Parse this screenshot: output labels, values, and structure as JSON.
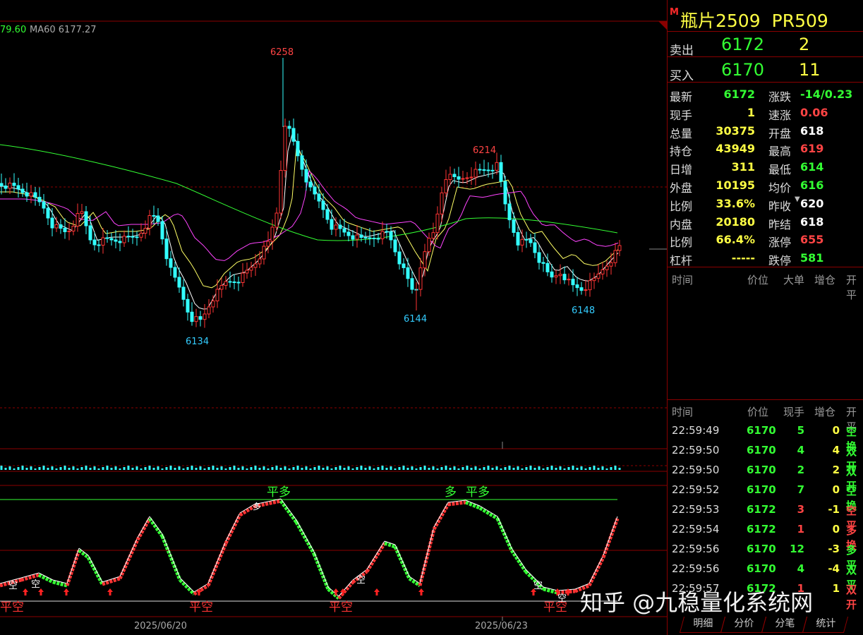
{
  "chart_data": {
    "type": "candlestick",
    "ma_legend": [
      {
        "text": "79.60",
        "color": "#33ff33"
      },
      {
        "text": "MA60 6177.27",
        "color": "#aaaaaa"
      }
    ],
    "price_labels": [
      {
        "text": "6258",
        "color": "#ff4444"
      },
      {
        "text": "6214",
        "color": "#ff4444"
      },
      {
        "text": "6134",
        "color": "#33ccff"
      },
      {
        "text": "6144",
        "color": "#33ccff"
      },
      {
        "text": "6148",
        "color": "#33ccff"
      }
    ],
    "x_axis_dates": [
      "2025/06/20",
      "2025/06/23"
    ],
    "osc_signals": [
      "平多",
      "平多",
      "多",
      "多",
      "空",
      "空",
      "空",
      "空",
      "平空",
      "平空",
      "平空",
      "平空",
      "空"
    ],
    "colors": {
      "up": "#ff3333",
      "down": "#33ffff",
      "ma5": "#ffffff",
      "ma10": "#ffff66",
      "ma20": "#ff44ff",
      "ma60": "#33ff33",
      "frame": "#8b0000"
    }
  },
  "header": {
    "marker": "M",
    "name": "瓶片2509",
    "code": "PR509"
  },
  "orderbook": [
    {
      "label": "卖出",
      "price": "6172",
      "qty": "2"
    },
    {
      "label": "买入",
      "price": "6170",
      "qty": "11"
    }
  ],
  "quote": [
    {
      "l1": "最新",
      "v1": "6172",
      "c1": "#33ff33",
      "l2": "涨跌",
      "v2": "-14/0.23",
      "c2": "#33ff33"
    },
    {
      "l1": "现手",
      "v1": "1",
      "c1": "#ffff44",
      "l2": "速涨",
      "v2": "0.06",
      "c2": "#ff4444"
    },
    {
      "l1": "总量",
      "v1": "30375",
      "c1": "#ffff44",
      "l2": "开盘",
      "v2": "618",
      "c2": "#ffffff"
    },
    {
      "l1": "持仓",
      "v1": "43949",
      "c1": "#ffff44",
      "l2": "最高",
      "v2": "619",
      "c2": "#ff4444"
    },
    {
      "l1": "日增",
      "v1": "311",
      "c1": "#ffff44",
      "l2": "最低",
      "v2": "614",
      "c2": "#33ff33"
    },
    {
      "l1": "外盘",
      "v1": "10195",
      "c1": "#ffff44",
      "l2": "均价",
      "v2": "616",
      "c2": "#33ff33"
    },
    {
      "l1": "比例",
      "v1": "33.6%",
      "c1": "#ffff44",
      "l2": "昨收",
      "v2": "620",
      "c2": "#ffffff"
    },
    {
      "l1": "内盘",
      "v1": "20180",
      "c1": "#ffff44",
      "l2": "昨结",
      "v2": "618",
      "c2": "#ffffff"
    },
    {
      "l1": "比例",
      "v1": "66.4%",
      "c1": "#ffff44",
      "l2": "涨停",
      "v2": "655",
      "c2": "#ff4444"
    },
    {
      "l1": "杠杆",
      "v1": "-----",
      "c1": "#ffff44",
      "l2": "跌停",
      "v2": "581",
      "c2": "#33ff33"
    }
  ],
  "big_orders_header": [
    "时间",
    "价位",
    "大单",
    "增仓",
    "开平"
  ],
  "ticks_header": [
    "时间",
    "价位",
    "现手",
    "增仓",
    "开平"
  ],
  "ticks": [
    {
      "time": "22:59:49",
      "price": "6170",
      "pc": "#33ff33",
      "vol": "5",
      "vc": "#33ff33",
      "chg": "0",
      "cc": "#ffff44",
      "type": "空换",
      "tc": "#33ff33"
    },
    {
      "time": "22:59:50",
      "price": "6170",
      "pc": "#33ff33",
      "vol": "4",
      "vc": "#33ff33",
      "chg": "4",
      "cc": "#ffff44",
      "type": "双开",
      "tc": "#33ff33"
    },
    {
      "time": "22:59:50",
      "price": "6170",
      "pc": "#33ff33",
      "vol": "2",
      "vc": "#33ff33",
      "chg": "2",
      "cc": "#ffff44",
      "type": "双开",
      "tc": "#33ff33"
    },
    {
      "time": "22:59:52",
      "price": "6170",
      "pc": "#33ff33",
      "vol": "7",
      "vc": "#33ff33",
      "chg": "0",
      "cc": "#ffff44",
      "type": "空换",
      "tc": "#33ff33"
    },
    {
      "time": "22:59:53",
      "price": "6172",
      "pc": "#33ff33",
      "vol": "3",
      "vc": "#ff4444",
      "chg": "-1",
      "cc": "#ffff44",
      "type": "空平",
      "tc": "#ff4444"
    },
    {
      "time": "22:59:54",
      "price": "6172",
      "pc": "#33ff33",
      "vol": "1",
      "vc": "#ff4444",
      "chg": "0",
      "cc": "#ffff44",
      "type": "多换",
      "tc": "#ff4444"
    },
    {
      "time": "22:59:56",
      "price": "6170",
      "pc": "#33ff33",
      "vol": "12",
      "vc": "#33ff33",
      "chg": "-3",
      "cc": "#ffff44",
      "type": "多平",
      "tc": "#33ff33"
    },
    {
      "time": "22:59:56",
      "price": "6170",
      "pc": "#33ff33",
      "vol": "4",
      "vc": "#33ff33",
      "chg": "-4",
      "cc": "#ffff44",
      "type": "双平",
      "tc": "#33ff33"
    },
    {
      "time": "22:59:57",
      "price": "6172",
      "pc": "#33ff33",
      "vol": "1",
      "vc": "#ff4444",
      "chg": "1",
      "cc": "#ffff44",
      "type": "双开",
      "tc": "#ff4444"
    }
  ],
  "tabs": [
    "明细",
    "分价",
    "分笔",
    "统计"
  ],
  "watermark": "知乎 @九稳量化系统网"
}
